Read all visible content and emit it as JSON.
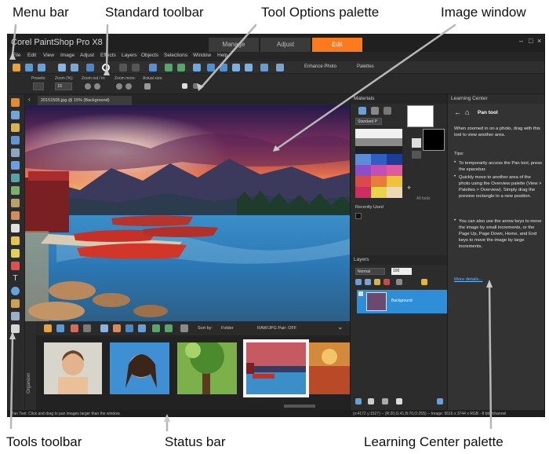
{
  "callouts": {
    "menu_bar": "Menu bar",
    "standard_toolbar": "Standard toolbar",
    "tool_options_palette": "Tool Options palette",
    "image_window": "Image window",
    "tools_toolbar": "Tools toolbar",
    "status_bar": "Status bar",
    "learning_center_palette": "Learning Center palette"
  },
  "app": {
    "title": "Corel PaintShop Pro X8",
    "workspace_tabs": [
      "Manage",
      "Adjust",
      "Edit"
    ],
    "active_tab": "Edit",
    "window_controls": [
      "–",
      "□",
      "×"
    ]
  },
  "menubar": {
    "items": [
      "File",
      "Edit",
      "View",
      "Image",
      "Adjust",
      "Effects",
      "Layers",
      "Objects",
      "Selections",
      "Window",
      "Help"
    ]
  },
  "standard_toolbar": {
    "enhance_photo": "Enhance Photo",
    "palettes": "Palettes"
  },
  "tool_options": {
    "presets_label": "Presets:",
    "zoom_label": "Zoom (%):",
    "zoom_value": "15",
    "zoom_inout_label": "Zoom out / in:",
    "zoom_more_label": "Zoom more:",
    "actual_size_label": "Actual size:"
  },
  "image_window": {
    "tab_title": "20151505.jpg @ 15% (Background)"
  },
  "organizer": {
    "side_label": "Organizer",
    "sort_by_label": "Sort by:",
    "sort_value": "Folder",
    "raw_jpg_label": "RAW/JPG Pair: OFF"
  },
  "materials": {
    "title": "Materials",
    "dropdown": "Standard P",
    "recently_used": "Recently Used",
    "all_tools": "All tools"
  },
  "layers": {
    "title": "Layers",
    "blend_mode": "Normal",
    "opacity": "100",
    "layer_name": "Background"
  },
  "learning_center": {
    "title": "Learning Center",
    "tool_name": "Pan tool",
    "intro": "When zoomed in on a photo, drag with this tool to view another area.",
    "tips_label": "Tips:",
    "tip1": "To temporarily access the Pan tool, press the spacebar.",
    "tip2": "Quickly move to another area of the photo using the Overview palette (View > Palettes > Overview). Simply drag the preview rectangle to a new position.",
    "tip3": "You can also use the arrow keys to move the image by small increments, or the Page Up, Page Down, Home, and End keys to move the image by large increments.",
    "more_link": "More details..."
  },
  "status_bar": {
    "message": "Pan Tool: Click and drag to pan images larger than the window.",
    "info": "(x:4172 y:1527) -- (R:20,G:41,B:70,O:255) -- Image: 5616 x 3744 x RGB - 8 bits/channel"
  },
  "colors": {
    "accent": "#ff7a1c",
    "layer_selected": "#2e8fd8",
    "link": "#6fb8ff"
  }
}
